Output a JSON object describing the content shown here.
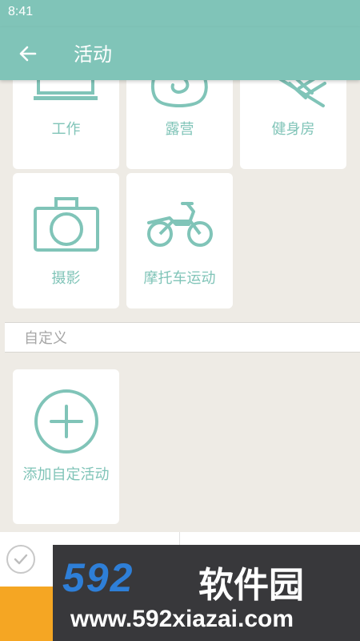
{
  "status_bar": {
    "time": "8:41"
  },
  "app_bar": {
    "title": "活动",
    "back_icon": "arrow-left-icon"
  },
  "activities": [
    {
      "label": "工作",
      "icon": "laptop-icon"
    },
    {
      "label": "露营",
      "icon": "camping-icon"
    },
    {
      "label": "健身房",
      "icon": "gym-icon"
    },
    {
      "label": "摄影",
      "icon": "camera-icon"
    },
    {
      "label": "摩托车运动",
      "icon": "motorcycle-icon"
    }
  ],
  "custom_section": {
    "title": "自定义"
  },
  "add_custom": {
    "label": "添加自定活动",
    "icon": "plus-circle-icon"
  },
  "watermark": {
    "number": "592",
    "brand": "软件园",
    "url": "www.592xiazai.com"
  },
  "colors": {
    "accent": "#80c4b8",
    "background": "#eeebe5",
    "tile": "#ffffff",
    "orange": "#f5a623",
    "watermark_bg": "#38383b"
  }
}
